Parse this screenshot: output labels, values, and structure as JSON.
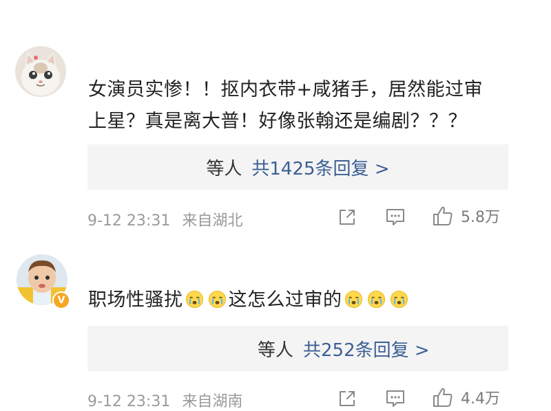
{
  "comments": [
    {
      "text_line1": "女演员实惨！！抠内衣带+咸猪手，居然能过审",
      "text_line2": "上星？真是离大普！好像张翰还是编剧？？？",
      "reply_names": "等人",
      "reply_count": "共1425条回复 >",
      "time": "9-12 23:31",
      "location": "来自湖北",
      "likes": "5.8万"
    },
    {
      "text_part1": "职场性骚扰",
      "text_part2": "这怎么过审的",
      "reply_names": "等人",
      "reply_count": "共252条回复 >",
      "time": "9-12 23:31",
      "location": "来自湖南",
      "likes": "4.4万"
    }
  ],
  "icons": {
    "share": "share-icon",
    "comment": "comment-icon",
    "like": "thumbs-up-icon",
    "emoji": "crying-face-emoji",
    "verified": "verified-badge-icon"
  },
  "colors": {
    "reply_link": "#3b5f94",
    "meta_gray": "#9a9a9a",
    "reply_bg": "#f4f4f4",
    "badge": "#f5a623"
  }
}
